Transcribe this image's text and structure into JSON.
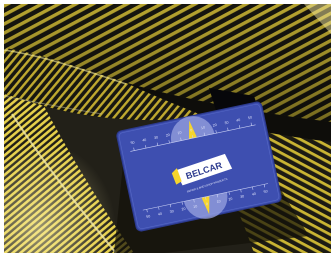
{
  "photo": {
    "subject": "Stripe reflection panels on a car body with a measuring card",
    "stripe_colors": {
      "yellow": "#d8c238",
      "dark": "#1a1912",
      "highlight": "#f4ea9a"
    },
    "background_color": "#222018"
  },
  "card": {
    "brand": "BELCAR",
    "tagline": "REPAIR & BODYSHOP PRODUCTS",
    "card_color": "#3e4fb0",
    "card_edge": "#2c3a8e",
    "marker_color": "#f6d52c",
    "dial_color": "#9aa3e0",
    "upper_scale": [
      "50",
      "40",
      "30",
      "20",
      "10",
      "0",
      "10",
      "20",
      "30",
      "40",
      "50"
    ],
    "lower_scale": [
      "50",
      "40",
      "30",
      "20",
      "10",
      "0",
      "10",
      "20",
      "30",
      "40",
      "50"
    ]
  }
}
